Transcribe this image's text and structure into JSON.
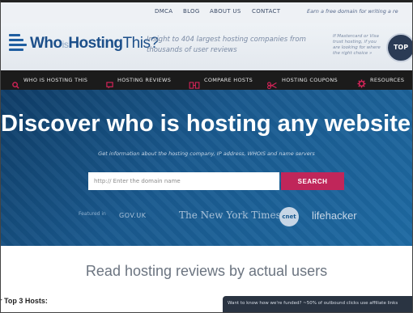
{
  "toplinks": {
    "items": [
      "DMCA",
      "BLOG",
      "ABOUT US",
      "CONTACT"
    ],
    "promo": "Earn a free domain for writing a re"
  },
  "header": {
    "logo_who": "Who",
    "logo_is": "is",
    "logo_hosting": "Hosting",
    "logo_this": "This?",
    "tagline": "Insight to 404 largest hosting companies from thousands of user reviews",
    "sidenote": "If Mastercard or Visa trust hosting, if you are looking for where the right choice »",
    "badge": "TOP"
  },
  "nav": {
    "items": [
      {
        "label": "WHO IS HOSTING THIS",
        "icon": "search-icon"
      },
      {
        "label": "HOSTING REVIEWS",
        "icon": "chat-icon"
      },
      {
        "label": "COMPARE HOSTS",
        "icon": "compare-icon"
      },
      {
        "label": "HOSTING COUPONS",
        "icon": "coupon-icon"
      },
      {
        "label": "RESOURCES",
        "icon": "gear-icon"
      }
    ]
  },
  "hero": {
    "title": "Discover who is hosting any website",
    "subtitle": "Get information about the hosting company, IP address, WHOIS and name servers",
    "search_placeholder": "http:// Enter the domain name",
    "search_button": "SEARCH",
    "featured_label": "Featured in",
    "press": [
      "GOV.UK",
      "The New York Times",
      "cnet",
      "lifehacker"
    ]
  },
  "reviews_title": "Read hosting reviews by actual users",
  "top3": "r Top 3 Hosts:",
  "notice": "Want to know how we're funded? ~50% of outbound clicks use affiliate links"
}
